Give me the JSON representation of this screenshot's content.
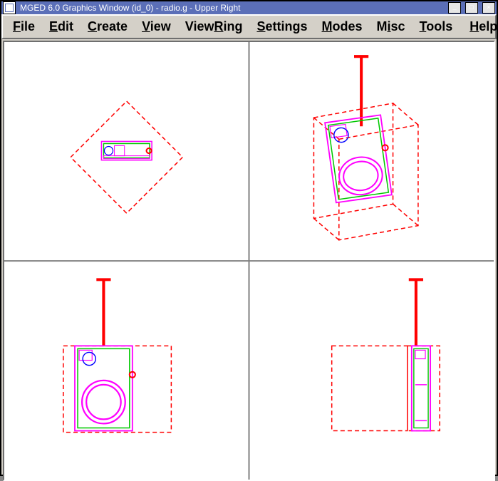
{
  "window": {
    "title": "MGED 6.0 Graphics Window (id_0) - radio.g - Upper Right"
  },
  "menubar": {
    "items": [
      {
        "label": "File",
        "mnemonic": "F"
      },
      {
        "label": "Edit",
        "mnemonic": "E"
      },
      {
        "label": "Create",
        "mnemonic": "C"
      },
      {
        "label": "View",
        "mnemonic": "V"
      },
      {
        "label": "ViewRing",
        "mnemonic": "R"
      },
      {
        "label": "Settings",
        "mnemonic": "S"
      },
      {
        "label": "Modes",
        "mnemonic": "M"
      },
      {
        "label": "Misc",
        "mnemonic": "i"
      },
      {
        "label": "Tools",
        "mnemonic": "T"
      },
      {
        "label": "Help",
        "mnemonic": "H",
        "align": "right"
      }
    ]
  },
  "viewport": {
    "layout": "quad",
    "panes": [
      "top",
      "perspective",
      "front",
      "right"
    ],
    "model": "radio.g"
  }
}
